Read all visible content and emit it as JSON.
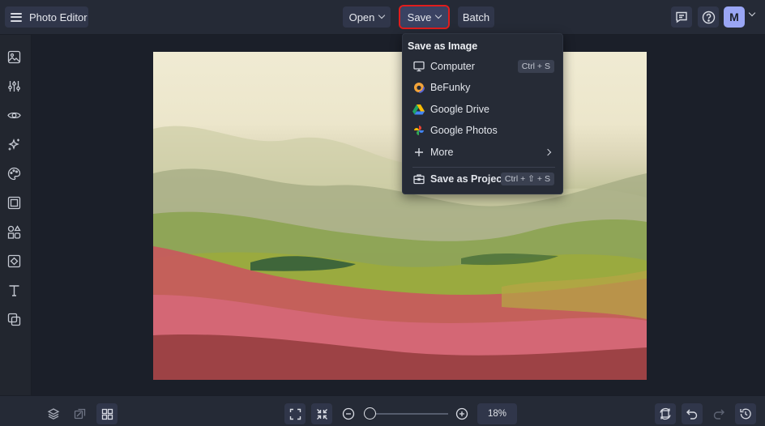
{
  "topbar": {
    "app_title": "Photo Editor",
    "open_label": "Open",
    "save_label": "Save",
    "batch_label": "Batch",
    "avatar_initial": "M"
  },
  "save_menu": {
    "header": "Save as Image",
    "items": [
      {
        "label": "Computer",
        "icon": "monitor-icon",
        "shortcut": "Ctrl + S"
      },
      {
        "label": "BeFunky",
        "icon": "befunky-logo-icon"
      },
      {
        "label": "Google Drive",
        "icon": "google-drive-icon"
      },
      {
        "label": "Google Photos",
        "icon": "google-photos-icon"
      },
      {
        "label": "More",
        "icon": "plus-icon"
      }
    ],
    "project": {
      "label": "Save as Project",
      "icon": "briefcase-icon",
      "shortcut": "Ctrl + ⇧ + S"
    }
  },
  "left_tools": [
    "image-icon",
    "sliders-icon",
    "eye-icon",
    "sparkles-icon",
    "palette-icon",
    "frame-icon",
    "shapes-icon",
    "texture-icon",
    "text-icon",
    "overlay-icon"
  ],
  "bottombar": {
    "zoom_value": "18%",
    "zoom_level_fraction": 0.18
  },
  "colors": {
    "save_highlight": "#e11d1d",
    "avatar_bg": "#9aa6f5",
    "panel_bg": "#252a36"
  }
}
